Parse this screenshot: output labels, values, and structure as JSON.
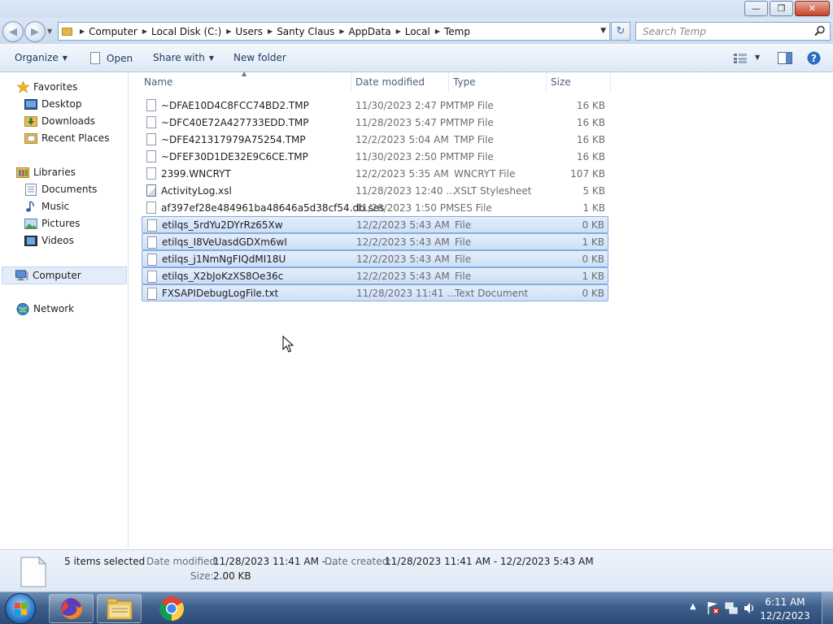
{
  "window": {
    "minimize_icon": "minimize-icon",
    "maximize_icon": "restore-icon",
    "close_icon": "close-icon"
  },
  "address": {
    "crumbs": [
      "Computer",
      "Local Disk (C:)",
      "Users",
      "Santy Claus",
      "AppData",
      "Local",
      "Temp"
    ],
    "search_placeholder": "Search Temp"
  },
  "toolbar": {
    "organize": "Organize",
    "open": "Open",
    "share_with": "Share with",
    "new_folder": "New folder"
  },
  "nav": {
    "favorites": "Favorites",
    "desktop": "Desktop",
    "downloads": "Downloads",
    "recent_places": "Recent Places",
    "libraries": "Libraries",
    "documents": "Documents",
    "music": "Music",
    "pictures": "Pictures",
    "videos": "Videos",
    "computer": "Computer",
    "network": "Network"
  },
  "columns": {
    "name": "Name",
    "date_modified": "Date modified",
    "type": "Type",
    "size": "Size"
  },
  "files": [
    {
      "name": "~DFAE10D4C8FCC74BD2.TMP",
      "date": "11/30/2023 2:47 PM",
      "type": "TMP File",
      "size": "16 KB",
      "selected": false
    },
    {
      "name": "~DFC40E72A427733EDD.TMP",
      "date": "11/28/2023 5:47 PM",
      "type": "TMP File",
      "size": "16 KB",
      "selected": false
    },
    {
      "name": "~DFE421317979A75254.TMP",
      "date": "12/2/2023 5:04 AM",
      "type": "TMP File",
      "size": "16 KB",
      "selected": false
    },
    {
      "name": "~DFEF30D1DE32E9C6CE.TMP",
      "date": "11/30/2023 2:50 PM",
      "type": "TMP File",
      "size": "16 KB",
      "selected": false
    },
    {
      "name": "2399.WNCRYT",
      "date": "12/2/2023 5:35 AM",
      "type": "WNCRYT File",
      "size": "107 KB",
      "selected": false
    },
    {
      "name": "ActivityLog.xsl",
      "date": "11/28/2023 12:40 ...",
      "type": "XSLT Stylesheet",
      "size": "5 KB",
      "selected": false
    },
    {
      "name": "af397ef28e484961ba48646a5d38cf54.db.ses",
      "date": "11/28/2023 1:50 PM",
      "type": "SES File",
      "size": "1 KB",
      "selected": false
    },
    {
      "name": "etilqs_5rdYu2DYrRz65Xw",
      "date": "12/2/2023 5:43 AM",
      "type": "File",
      "size": "0 KB",
      "selected": true
    },
    {
      "name": "etilqs_I8VeUasdGDXm6wI",
      "date": "12/2/2023 5:43 AM",
      "type": "File",
      "size": "1 KB",
      "selected": true
    },
    {
      "name": "etilqs_j1NmNgFIQdMI18U",
      "date": "12/2/2023 5:43 AM",
      "type": "File",
      "size": "0 KB",
      "selected": true
    },
    {
      "name": "etilqs_X2bJoKzXS8Oe36c",
      "date": "12/2/2023 5:43 AM",
      "type": "File",
      "size": "1 KB",
      "selected": true
    },
    {
      "name": "FXSAPIDebugLogFile.txt",
      "date": "11/28/2023 11:41 ...",
      "type": "Text Document",
      "size": "0 KB",
      "selected": true
    }
  ],
  "details": {
    "count": "5 items selected",
    "date_modified_label": "Date modified:",
    "date_modified_value": "11/28/2023 11:41 AM - ...",
    "date_created_label": "Date created:",
    "date_created_value": "11/28/2023 11:41 AM - 12/2/2023 5:43 AM",
    "size_label": "Size:",
    "size_value": "2.00 KB"
  },
  "taskbar": {
    "time": "6:11 AM",
    "date": "12/2/2023"
  },
  "colors": {
    "selection_fill": "#cde0f7",
    "selection_border": "#84acdd",
    "taskbar": "#3d5f8b"
  }
}
